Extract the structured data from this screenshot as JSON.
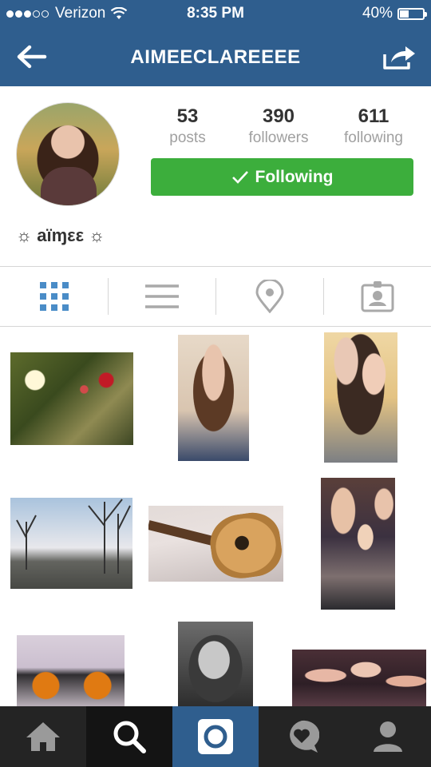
{
  "status_bar": {
    "carrier": "Verizon",
    "time": "8:35 PM",
    "battery": "40%",
    "battery_level": 0.4,
    "signal_bars_filled": 3,
    "signal_bars_total": 5
  },
  "nav": {
    "title": "AIMEECLAREEEE",
    "back_icon": "back-arrow-icon",
    "share_icon": "share-icon"
  },
  "profile": {
    "stats": [
      {
        "value": "53",
        "label": "posts"
      },
      {
        "value": "390",
        "label": "followers"
      },
      {
        "value": "611",
        "label": "following"
      }
    ],
    "follow_button_label": "Following",
    "display_name": "☼ aïɱεε ☼"
  },
  "view_tabs": [
    "grid-icon",
    "list-icon",
    "location-pin-icon",
    "tagged-person-icon"
  ],
  "bottom_tabs": [
    "home-icon",
    "search-icon",
    "camera-icon",
    "activity-icon",
    "profile-icon"
  ],
  "colors": {
    "header": "#2f5e8e",
    "follow_green": "#3cae3c",
    "active_tab": "#4a8cc7"
  }
}
